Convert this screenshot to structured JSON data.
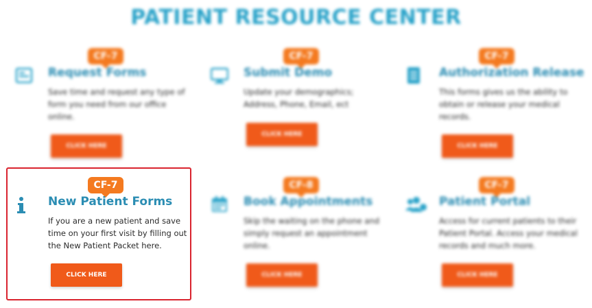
{
  "page": {
    "title": "PATIENT RESOURCE CENTER"
  },
  "colors": {
    "accent_blue": "#2aa3c9",
    "card_title_blue": "#2b8db3",
    "badge_orange": "#f47a20",
    "button_orange": "#f05a1a",
    "focus_red": "#d9232e"
  },
  "cards": [
    {
      "badge": "CF-7",
      "icon": "form-icon",
      "title": "Request Forms",
      "description": "Save time and request any type of form you need from our office online.",
      "button": "CLICK HERE"
    },
    {
      "badge": "CF-7",
      "icon": "monitor-icon",
      "title": "Submit Demo",
      "description": "Update your demographics; Address, Phone, Email, ect",
      "button": "CLICK HERE"
    },
    {
      "badge": "CF-7",
      "icon": "document-icon",
      "title": "Authorization Release",
      "description": "This forms gives us the ability to obtain or release your medical records.",
      "button": "CLICK HERE"
    },
    {
      "badge": "CF-7",
      "icon": "info-icon",
      "title": "New Patient Forms",
      "description": "If you are a new patient and save time on your first visit by filling out the New Patient Packet here.",
      "button": "CLICK HERE",
      "highlighted": true
    },
    {
      "badge": "CF-8",
      "icon": "calendar-icon",
      "title": "Book Appointments",
      "description": "Skip the waiting on the phone and simply request an appointment online.",
      "button": "CLICK HERE"
    },
    {
      "badge": "CF-7",
      "icon": "users-icon",
      "title": "Patient Portal",
      "description": "Access for current patients to their Patient Portal. Access your medical records and much more.",
      "button": "CLICK HERE"
    }
  ]
}
